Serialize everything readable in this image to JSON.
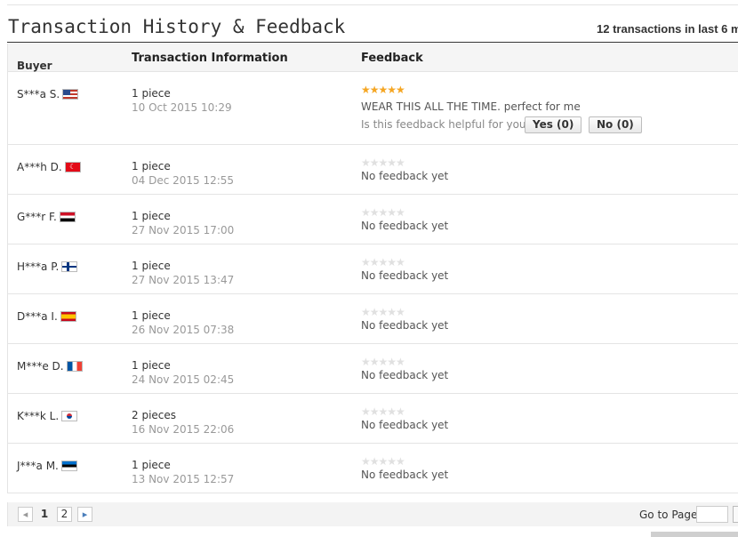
{
  "header": {
    "title": "Transaction History & Feedback",
    "count_text": "12 transactions in last 6 m"
  },
  "columns": {
    "buyer": "Buyer",
    "info": "Transaction Information",
    "feedback": "Feedback"
  },
  "rows": [
    {
      "buyer": "S***a S.",
      "flag": "us",
      "quantity": "1 piece",
      "date": "10 Oct 2015 10:29",
      "rating": 5,
      "feedback": "WEAR THIS ALL THE TIME. perfect for me",
      "helpful_prompt": "Is this feedback helpful for you?",
      "yes_label": "Yes (0)",
      "no_label": "No (0)"
    },
    {
      "buyer": "A***h D.",
      "flag": "tr",
      "quantity": "1 piece",
      "date": "04 Dec 2015 12:55",
      "rating": 0,
      "feedback": "No feedback yet"
    },
    {
      "buyer": "G***r F.",
      "flag": "eg",
      "quantity": "1 piece",
      "date": "27 Nov 2015 17:00",
      "rating": 0,
      "feedback": "No feedback yet"
    },
    {
      "buyer": "H***a P.",
      "flag": "fi",
      "quantity": "1 piece",
      "date": "27 Nov 2015 13:47",
      "rating": 0,
      "feedback": "No feedback yet"
    },
    {
      "buyer": "D***a I.",
      "flag": "es",
      "quantity": "1 piece",
      "date": "26 Nov 2015 07:38",
      "rating": 0,
      "feedback": "No feedback yet"
    },
    {
      "buyer": "M***e D.",
      "flag": "fr",
      "quantity": "1 piece",
      "date": "24 Nov 2015 02:45",
      "rating": 0,
      "feedback": "No feedback yet"
    },
    {
      "buyer": "K***k L.",
      "flag": "kr",
      "quantity": "2 pieces",
      "date": "16 Nov 2015 22:06",
      "rating": 0,
      "feedback": "No feedback yet"
    },
    {
      "buyer": "J***a M.",
      "flag": "ee",
      "quantity": "1 piece",
      "date": "13 Nov 2015 12:57",
      "rating": 0,
      "feedback": "No feedback yet"
    }
  ],
  "pagination": {
    "pages": [
      "1",
      "2"
    ],
    "current": "1",
    "goto_label": "Go to Page",
    "prev_icon": "chevron-left-icon",
    "next_icon": "chevron-right-icon"
  },
  "colors": {
    "star_filled": "#f5a623",
    "star_empty": "#e0e0e0",
    "date_gray": "#999999"
  }
}
